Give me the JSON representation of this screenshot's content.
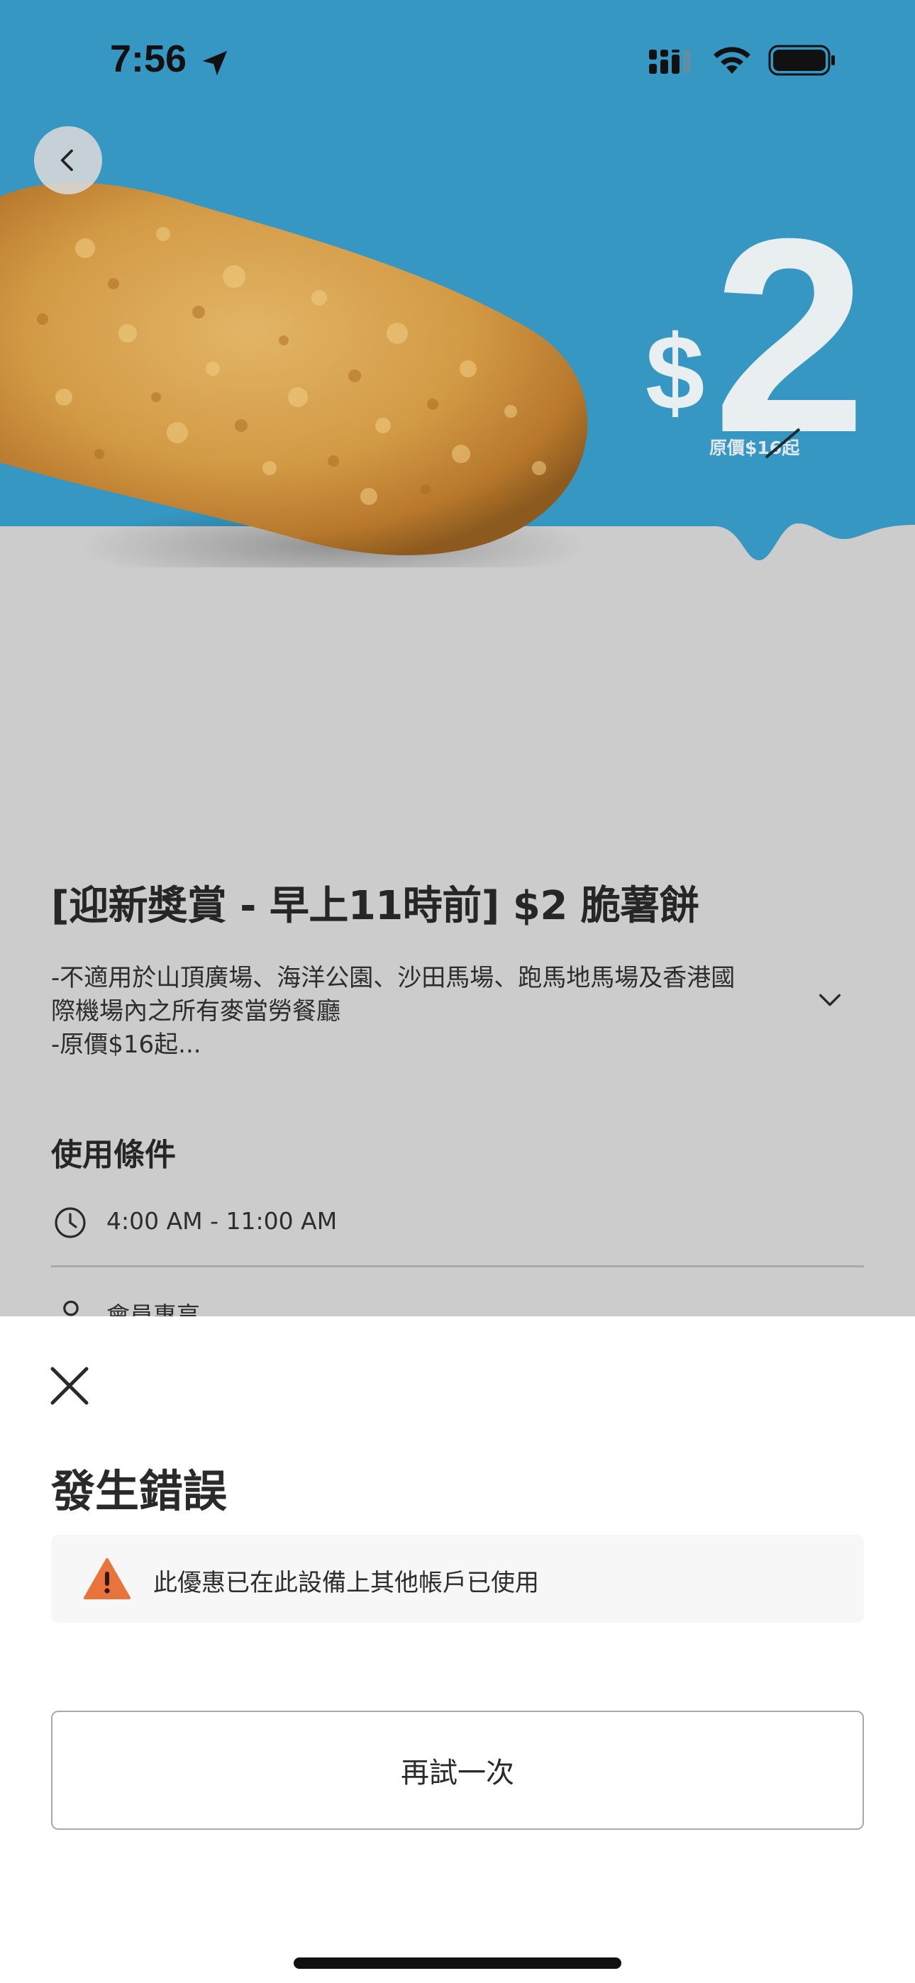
{
  "status_bar": {
    "time": "7:56",
    "icons": [
      "location-arrow-icon",
      "cellular-signal-icon",
      "wifi-icon",
      "battery-icon"
    ]
  },
  "hero": {
    "background_color": "#3597c2",
    "lower_background_color": "#cccccc",
    "currency": "$",
    "price": "2",
    "original_price_prefix": "原價$1",
    "original_price_struck_digit": "6",
    "original_price_suffix": "起",
    "image": "hash-brown-image",
    "back_icon": "chevron-left-icon"
  },
  "offer": {
    "title": "[迎新獎賞 - 早上11時前] $2 脆薯餅",
    "description_lines": [
      "-不適用於山頂廣場、海洋公園、沙田馬場、跑馬地馬場及香港國",
      "際機場內之所有麥當勞餐廳",
      "-原價$16起..."
    ],
    "expand_icon": "chevron-down-icon"
  },
  "conditions": {
    "heading": "使用條件",
    "time_range": "4:00 AM - 11:00 AM",
    "member_only": "會員專享"
  },
  "error_sheet": {
    "title": "發生錯誤",
    "message": "此優惠已在此設備上其他帳戶已使用",
    "retry_label": "再試一次",
    "warning_color": "#e8743b"
  }
}
